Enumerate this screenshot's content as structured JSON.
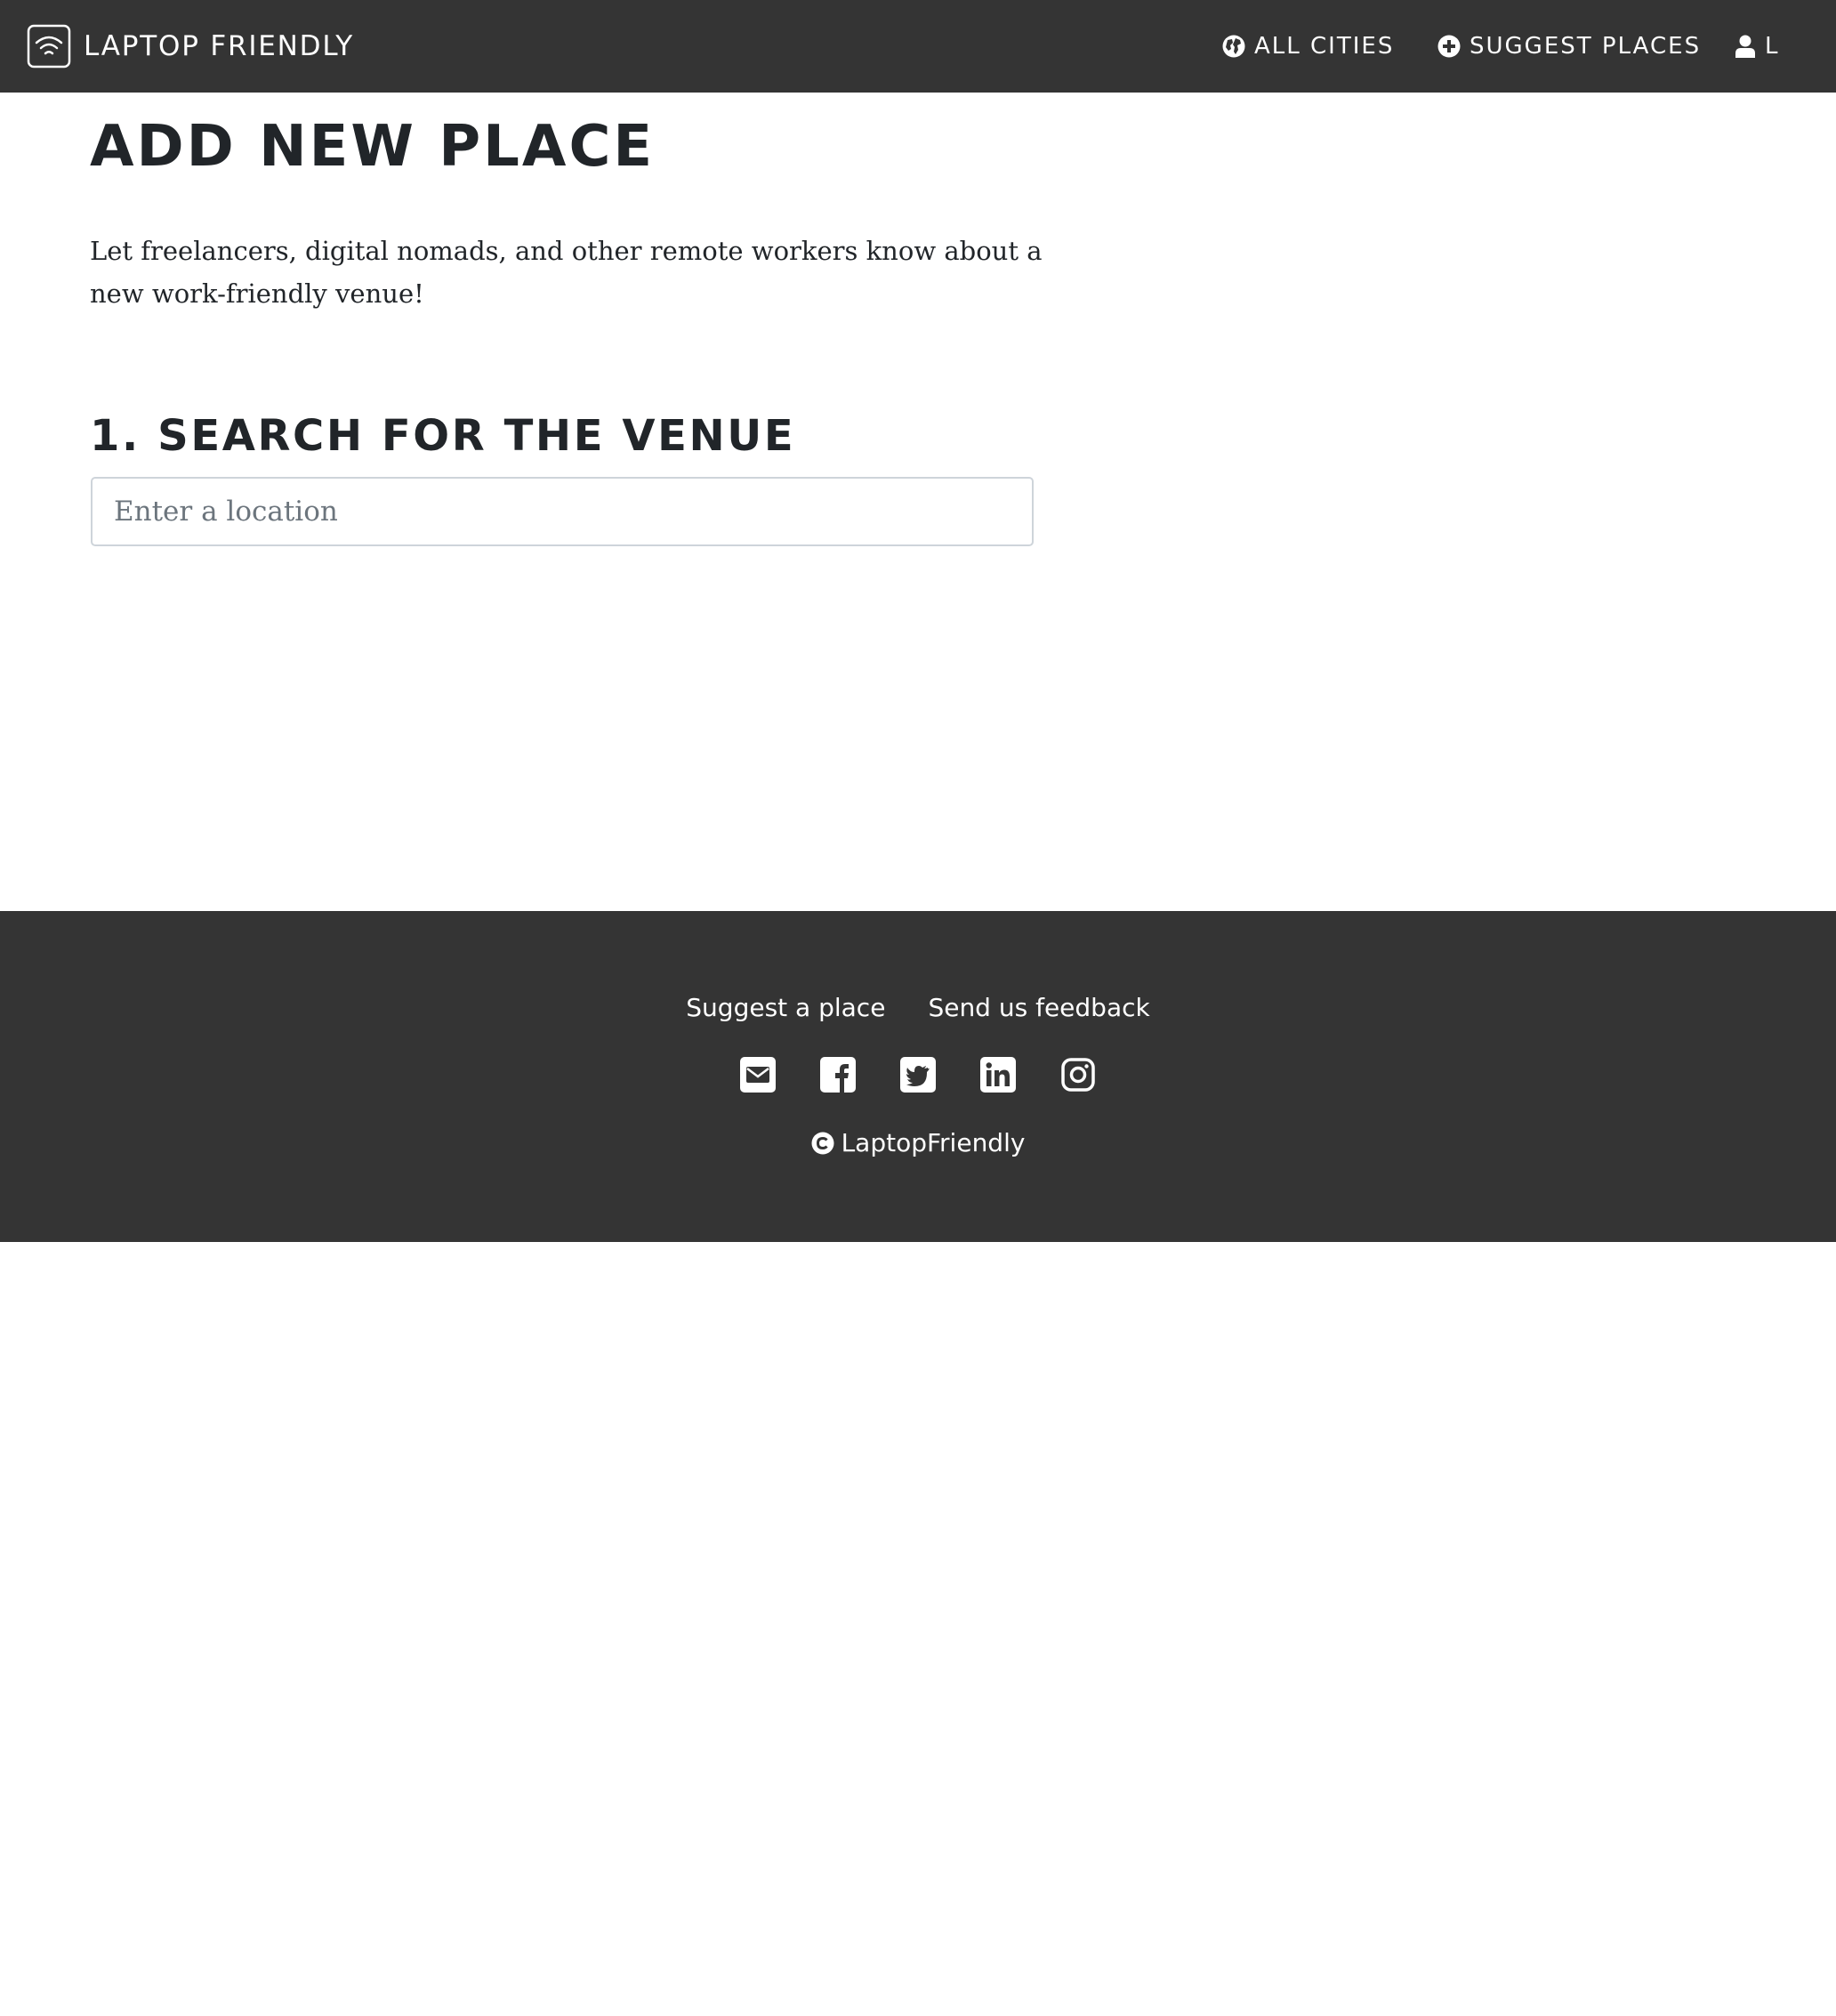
{
  "navbar": {
    "brand": "LAPTOP FRIENDLY",
    "brand_icon": "wifi-icon",
    "items": [
      {
        "label": "ALL CITIES",
        "icon": "globe-icon"
      },
      {
        "label": "SUGGEST PLACES",
        "icon": "plus-circle-icon"
      },
      {
        "label": "L",
        "icon": "user-icon"
      }
    ]
  },
  "main": {
    "title": "ADD NEW PLACE",
    "intro": "Let freelancers, digital nomads, and other remote workers know about a new work-friendly venue!",
    "step_title": "1. SEARCH FOR THE VENUE",
    "search": {
      "placeholder": "Enter a location",
      "value": ""
    }
  },
  "footer": {
    "links": [
      "Suggest a place",
      "Send us feedback"
    ],
    "social_icons": [
      "envelope-icon",
      "facebook-icon",
      "twitter-icon",
      "linkedin-icon",
      "instagram-icon"
    ],
    "copyright": "LaptopFriendly"
  },
  "colors": {
    "navbar_bg": "#343434",
    "footer_bg": "#343434",
    "text": "#212529",
    "input_border": "#ced4da"
  }
}
